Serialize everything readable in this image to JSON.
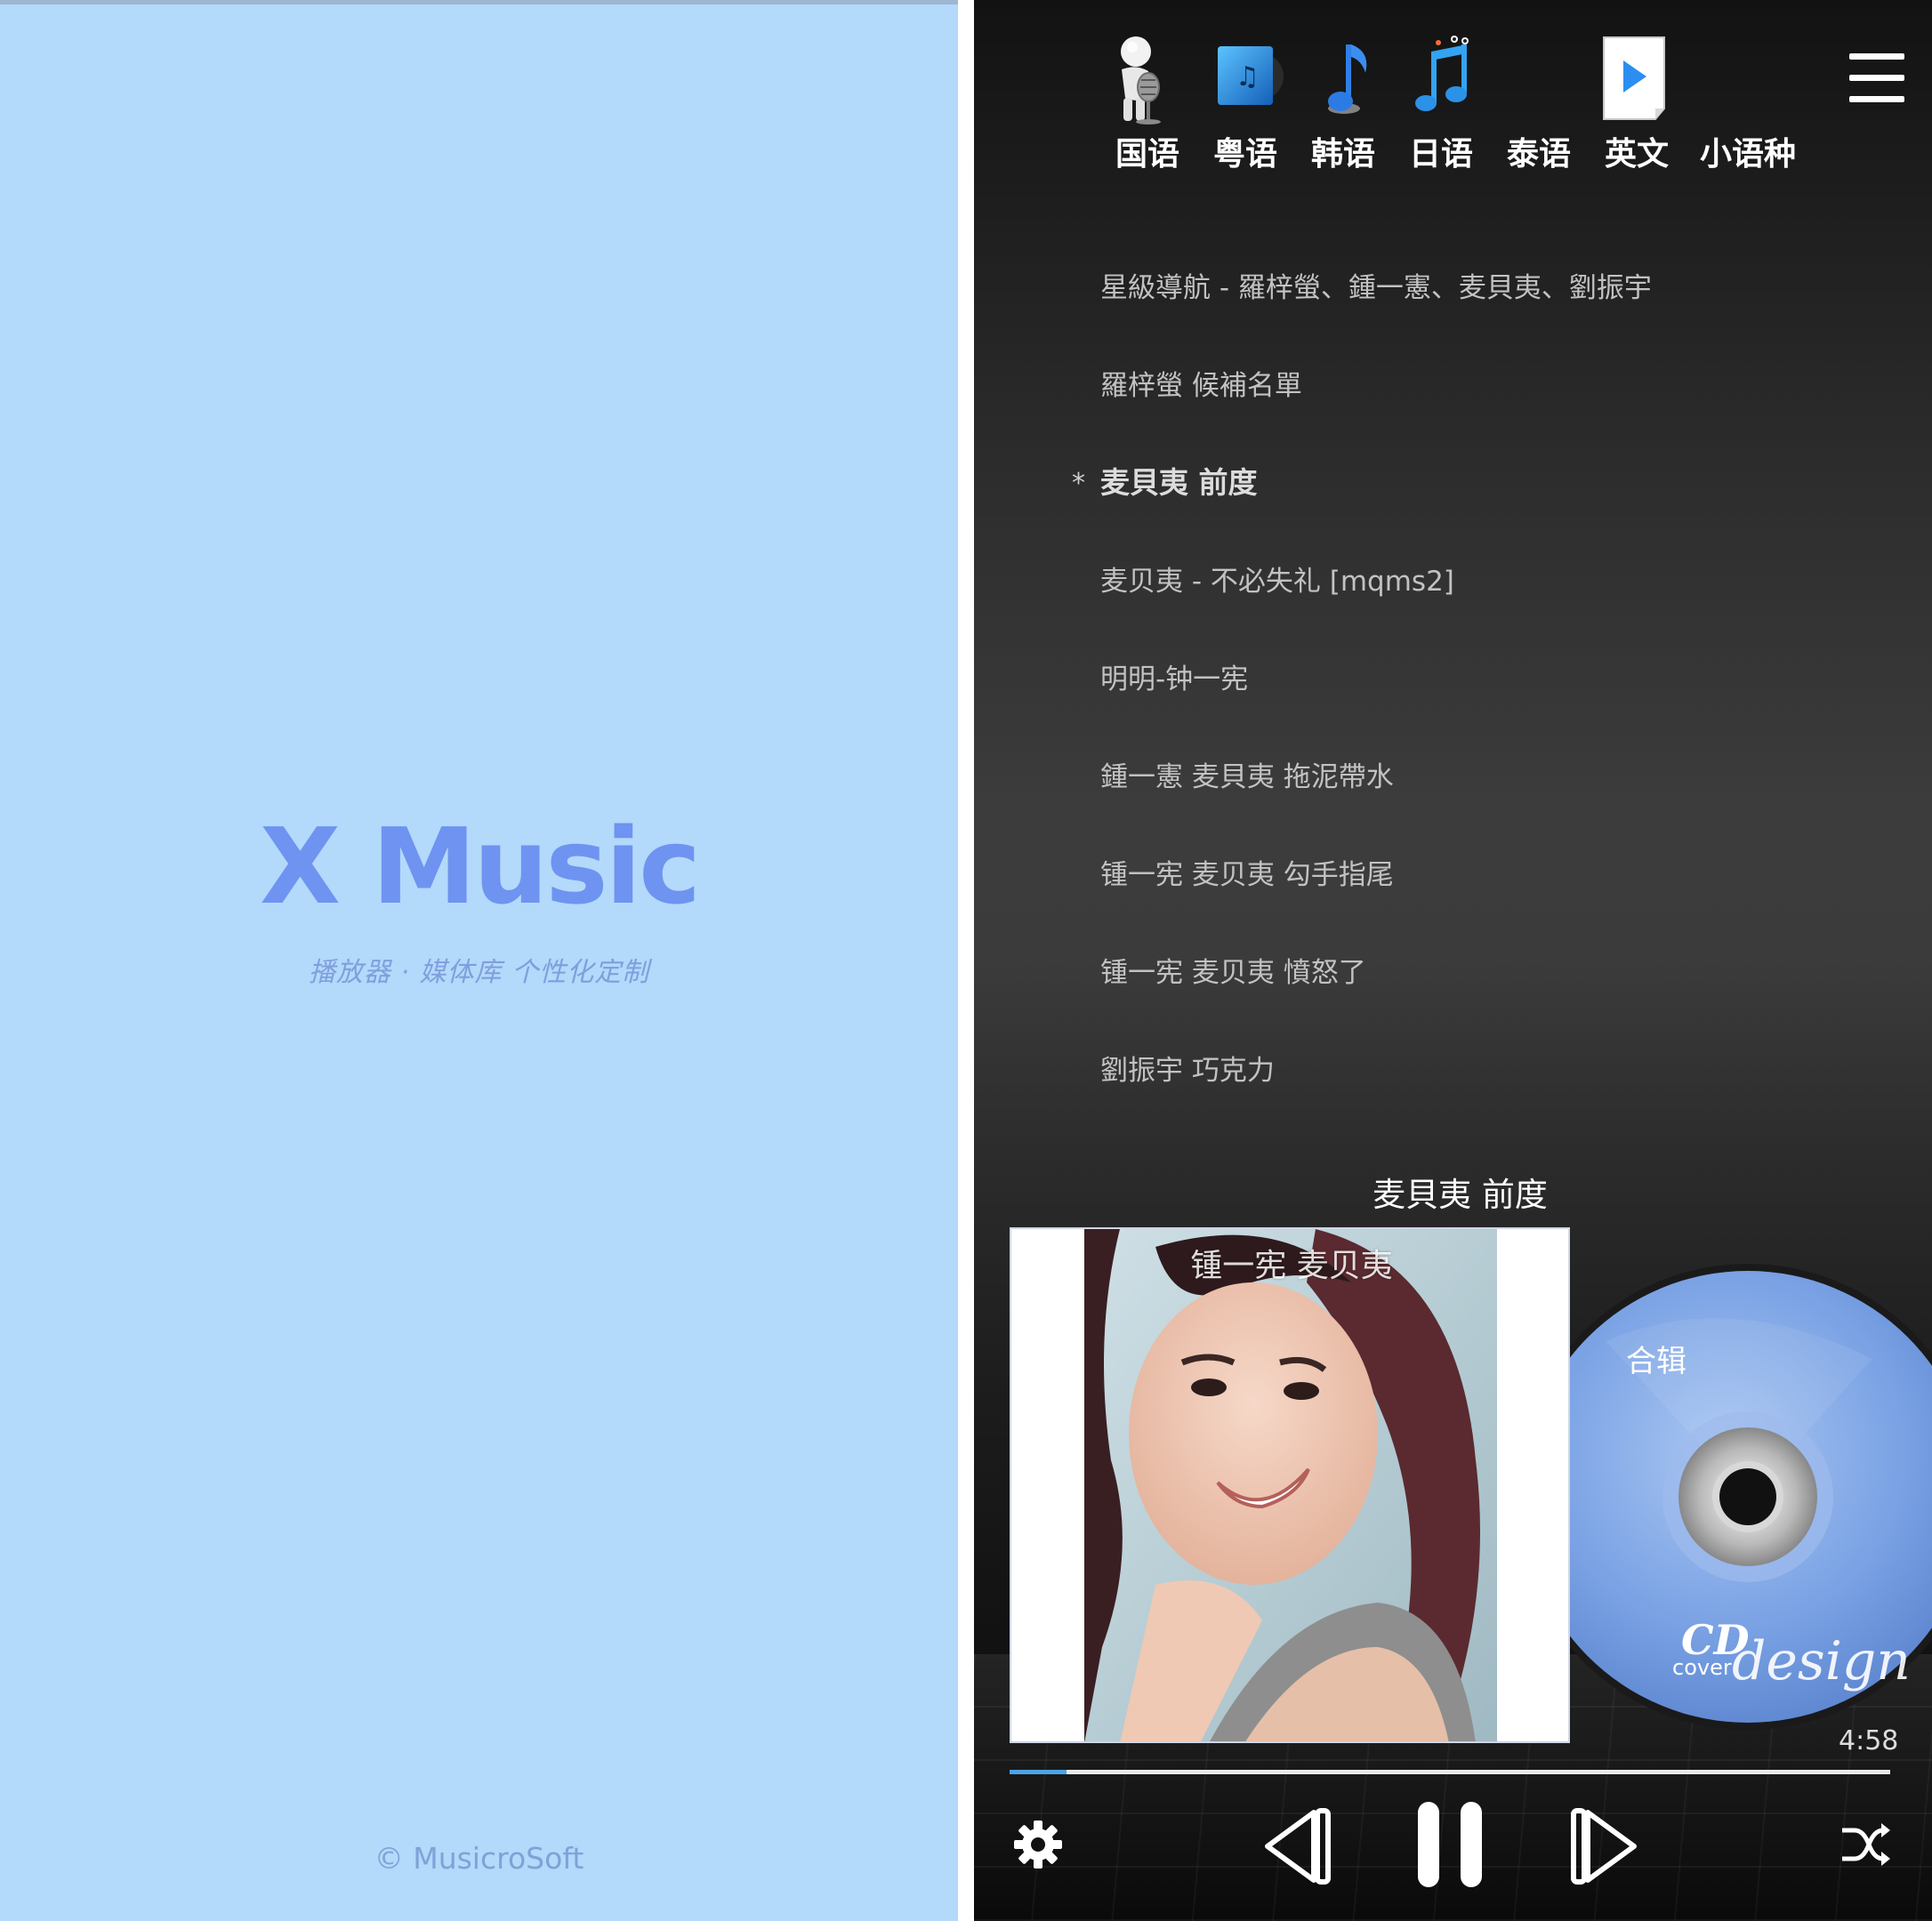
{
  "splash": {
    "app_title": "X Music",
    "subtitle": "播放器 · 媒体库  个性化定制",
    "copyright": "© MusicroSoft"
  },
  "player": {
    "categories": [
      {
        "label": "国语",
        "icon": "microphone-person-icon"
      },
      {
        "label": "粤语",
        "icon": "music-album-icon"
      },
      {
        "label": "韩语",
        "icon": "music-note-icon"
      },
      {
        "label": "日语",
        "icon": "double-music-note-icon"
      },
      {
        "label": "泰语",
        "icon": "dancing-notes-icon"
      },
      {
        "label": "英文",
        "icon": "play-document-icon"
      },
      {
        "label": "小语种",
        "icon": "play-document-icon"
      }
    ],
    "menu_icon": "hamburger-menu-icon",
    "songs": [
      "星級導航 - 羅梓螢、鍾一憲、麦貝夷、劉振宇",
      "羅梓螢 候補名單",
      "麦貝夷 前度",
      "麦贝夷 - 不必失礼 [mqms2]",
      "明明-钟一宪",
      "鍾一憲 麦貝夷 拖泥帶水",
      "锺一宪 麦贝夷 勾手指尾",
      "锺一宪 麦贝夷 憤怒了",
      "劉振宇 巧克力"
    ],
    "current_song_index": 2,
    "current_marker": "*",
    "now_playing": {
      "title": "麦貝夷 前度",
      "artist": "锺一宪 麦贝夷",
      "album": "合辑",
      "duration": "4:58",
      "progress": 0.065
    },
    "controls": {
      "settings_icon": "gear-icon",
      "prev_icon": "previous-icon",
      "pause_icon": "pause-icon",
      "next_icon": "next-icon",
      "shuffle_icon": "shuffle-icon"
    },
    "colors": {
      "splash_bg": "#b3d9fb",
      "title_color": "#6f93f0",
      "accent": "#4ba3e6"
    }
  }
}
